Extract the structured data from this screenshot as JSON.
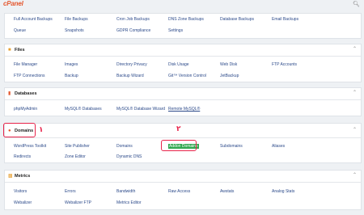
{
  "header": {
    "logo": "cPanel",
    "search_icon": "search-icon"
  },
  "panels": {
    "backups": {
      "items": [
        "Full Account Backups",
        "File Backups",
        "Cron Job Backups",
        "DNS Zone Backups",
        "Database Backups",
        "Email Backups",
        "Queue",
        "Snapshots",
        "GDPR Compliance",
        "Settings"
      ]
    },
    "files": {
      "title": "Files",
      "items": [
        "File Manager",
        "Images",
        "Directory Privacy",
        "Disk Usage",
        "Web Disk",
        "FTP Accounts",
        "FTP Connections",
        "Backup",
        "Backup Wizard",
        "Git™ Version Control",
        "JetBackup"
      ]
    },
    "databases": {
      "title": "Databases",
      "items": [
        "phpMyAdmin",
        "MySQL® Databases",
        "MySQL® Database Wizard",
        "Remote MySQL®"
      ]
    },
    "domains": {
      "title": "Domains",
      "items": [
        "WordPress Toolkit",
        "Site Publisher",
        "Domains",
        "Addon Domains",
        "Subdomains",
        "Aliases",
        "Redirects",
        "Zone Editor",
        "Dynamic DNS"
      ]
    },
    "metrics": {
      "title": "Metrics",
      "items": [
        "Visitors",
        "Errors",
        "Bandwidth",
        "Raw Access",
        "Awstats",
        "Analog Stats",
        "Webalizer",
        "Webalizer FTP",
        "Metrics Editor"
      ]
    }
  },
  "annotations": {
    "one": "١",
    "two": "٢"
  },
  "colors": {
    "accent": "#e8234a",
    "highlight": "#2fa84f",
    "link": "#2c4a8a",
    "logo": "#e4572e"
  }
}
